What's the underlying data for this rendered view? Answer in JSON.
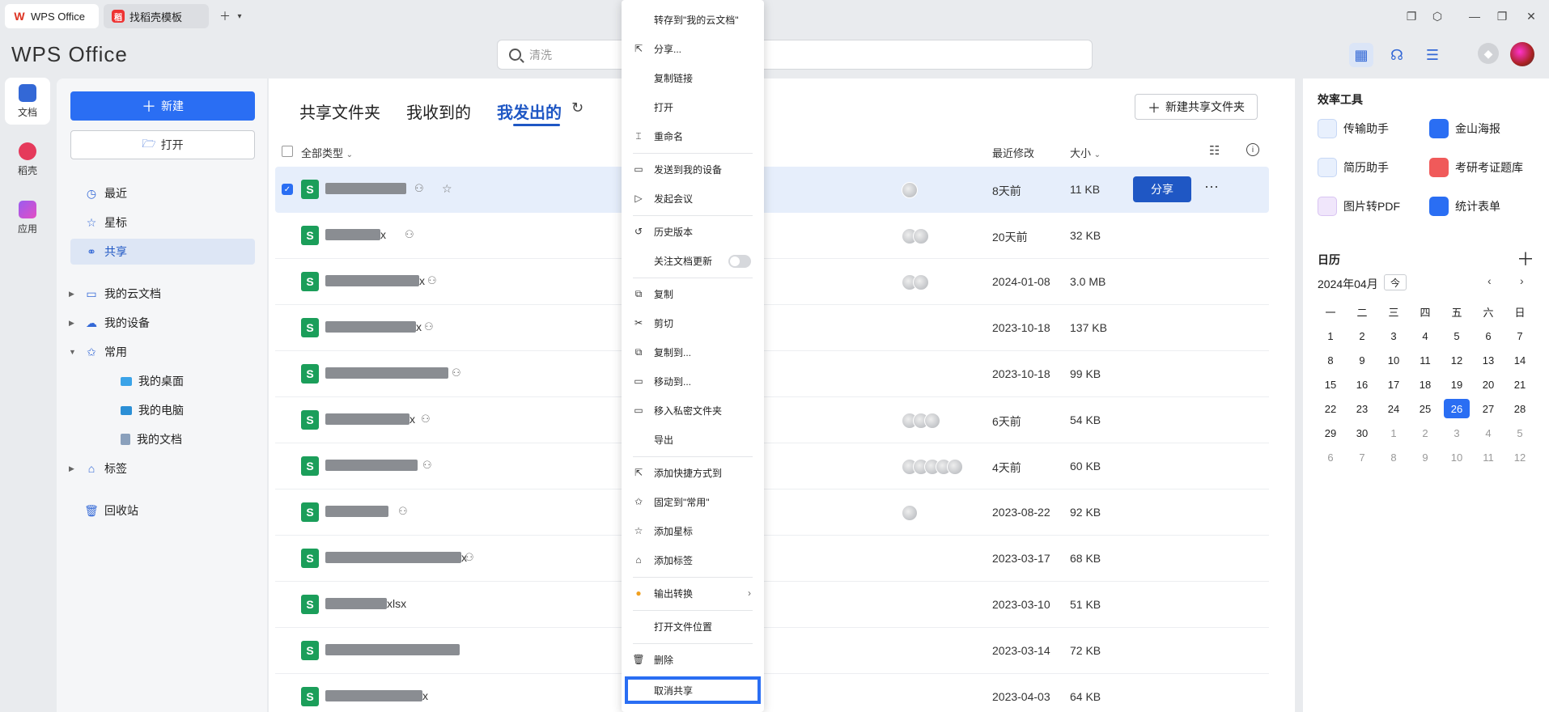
{
  "tabs": [
    {
      "label": "WPS Office",
      "icon": "wps-logo-icon"
    },
    {
      "label": "找稻壳模板",
      "icon": "daoke-icon"
    }
  ],
  "app": {
    "logo": "WPS Office"
  },
  "search": {
    "placeholder": "清洗"
  },
  "rail": [
    {
      "label": "文档"
    },
    {
      "label": "稻壳"
    },
    {
      "label": "应用"
    }
  ],
  "nav": {
    "new_label": "新建",
    "open_label": "打开",
    "items": [
      {
        "label": "最近"
      },
      {
        "label": "星标"
      },
      {
        "label": "共享"
      },
      {
        "label": "我的云文档"
      },
      {
        "label": "我的设备"
      },
      {
        "label": "常用"
      },
      {
        "label": "我的桌面"
      },
      {
        "label": "我的电脑"
      },
      {
        "label": "我的文档"
      },
      {
        "label": "标签"
      },
      {
        "label": "回收站"
      }
    ]
  },
  "main": {
    "tabs": [
      {
        "label": "共享文件夹"
      },
      {
        "label": "我收到的"
      },
      {
        "label": "我发出的"
      }
    ],
    "new_share_label": "新建共享文件夹",
    "columns": {
      "type": "全部类型",
      "modified": "最近修改",
      "size": "大小"
    },
    "share_button": "分享",
    "rows": [
      {
        "suffix": "",
        "date": "8天前",
        "size": "11 KB"
      },
      {
        "suffix": "x",
        "date": "20天前",
        "size": "32 KB"
      },
      {
        "suffix": "x",
        "date": "2024-01-08",
        "size": "3.0 MB"
      },
      {
        "suffix": "x",
        "date": "2023-10-18",
        "size": "137 KB"
      },
      {
        "suffix": "",
        "date": "2023-10-18",
        "size": "99 KB"
      },
      {
        "suffix": "x",
        "date": "6天前",
        "size": "54 KB"
      },
      {
        "suffix": "",
        "date": "4天前",
        "size": "60 KB"
      },
      {
        "suffix": "",
        "date": "2023-08-22",
        "size": "92 KB"
      },
      {
        "suffix": "x",
        "date": "2023-03-17",
        "size": "68 KB"
      },
      {
        "suffix": "xlsx",
        "date": "2023-03-10",
        "size": "51 KB"
      },
      {
        "suffix": "",
        "date": "2023-03-14",
        "size": "72 KB"
      },
      {
        "suffix": "x",
        "date": "2023-04-03",
        "size": "64 KB"
      }
    ]
  },
  "tools": {
    "title": "效率工具",
    "items": [
      {
        "label": "传输助手"
      },
      {
        "label": "金山海报"
      },
      {
        "label": "简历助手"
      },
      {
        "label": "考研考证题库"
      },
      {
        "label": "图片转PDF"
      },
      {
        "label": "统计表单"
      }
    ]
  },
  "calendar": {
    "title": "日历",
    "month": "2024年04月",
    "today_btn": "今",
    "weekdays": [
      "一",
      "二",
      "三",
      "四",
      "五",
      "六",
      "日"
    ],
    "days": [
      "1",
      "2",
      "3",
      "4",
      "5",
      "6",
      "7",
      "8",
      "9",
      "10",
      "11",
      "12",
      "13",
      "14",
      "15",
      "16",
      "17",
      "18",
      "19",
      "20",
      "21",
      "22",
      "23",
      "24",
      "25",
      "26",
      "27",
      "28",
      "29",
      "30",
      "1",
      "2",
      "3",
      "4",
      "5",
      "6",
      "7",
      "8",
      "9",
      "10",
      "11",
      "12"
    ]
  },
  "menu": [
    {
      "label": "转存到\"我的云文档\""
    },
    {
      "label": "分享..."
    },
    {
      "label": "复制链接"
    },
    {
      "label": "打开"
    },
    {
      "label": "重命名"
    },
    {
      "label": "发送到我的设备"
    },
    {
      "label": "发起会议"
    },
    {
      "label": "历史版本"
    },
    {
      "label": "关注文档更新"
    },
    {
      "label": "复制"
    },
    {
      "label": "剪切"
    },
    {
      "label": "复制到..."
    },
    {
      "label": "移动到..."
    },
    {
      "label": "移入私密文件夹"
    },
    {
      "label": "导出"
    },
    {
      "label": "添加快捷方式到"
    },
    {
      "label": "固定到\"常用\""
    },
    {
      "label": "添加星标"
    },
    {
      "label": "添加标签"
    },
    {
      "label": "输出转换"
    },
    {
      "label": "打开文件位置"
    },
    {
      "label": "删除"
    },
    {
      "label": "取消共享"
    }
  ]
}
